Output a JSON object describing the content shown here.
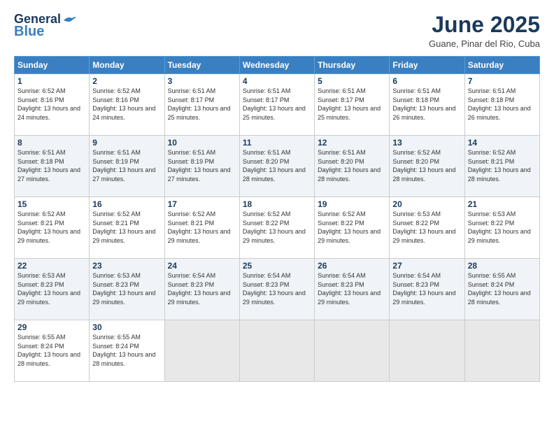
{
  "header": {
    "logo_line1": "General",
    "logo_line2": "Blue",
    "title": "June 2025",
    "subtitle": "Guane, Pinar del Rio, Cuba"
  },
  "calendar": {
    "headers": [
      "Sunday",
      "Monday",
      "Tuesday",
      "Wednesday",
      "Thursday",
      "Friday",
      "Saturday"
    ],
    "weeks": [
      [
        {
          "empty": true
        },
        {
          "empty": true
        },
        {
          "empty": true
        },
        {
          "empty": true
        },
        {
          "empty": true
        },
        {
          "empty": true
        },
        {
          "empty": true
        }
      ]
    ],
    "days": {
      "1": {
        "rise": "6:52 AM",
        "set": "8:16 PM",
        "hours": "13 hours and 24 minutes."
      },
      "2": {
        "rise": "6:52 AM",
        "set": "8:16 PM",
        "hours": "13 hours and 24 minutes."
      },
      "3": {
        "rise": "6:51 AM",
        "set": "8:17 PM",
        "hours": "13 hours and 25 minutes."
      },
      "4": {
        "rise": "6:51 AM",
        "set": "8:17 PM",
        "hours": "13 hours and 25 minutes."
      },
      "5": {
        "rise": "6:51 AM",
        "set": "8:17 PM",
        "hours": "13 hours and 25 minutes."
      },
      "6": {
        "rise": "6:51 AM",
        "set": "8:18 PM",
        "hours": "13 hours and 26 minutes."
      },
      "7": {
        "rise": "6:51 AM",
        "set": "8:18 PM",
        "hours": "13 hours and 26 minutes."
      },
      "8": {
        "rise": "6:51 AM",
        "set": "8:18 PM",
        "hours": "13 hours and 27 minutes."
      },
      "9": {
        "rise": "6:51 AM",
        "set": "8:19 PM",
        "hours": "13 hours and 27 minutes."
      },
      "10": {
        "rise": "6:51 AM",
        "set": "8:19 PM",
        "hours": "13 hours and 27 minutes."
      },
      "11": {
        "rise": "6:51 AM",
        "set": "8:20 PM",
        "hours": "13 hours and 28 minutes."
      },
      "12": {
        "rise": "6:51 AM",
        "set": "8:20 PM",
        "hours": "13 hours and 28 minutes."
      },
      "13": {
        "rise": "6:52 AM",
        "set": "8:20 PM",
        "hours": "13 hours and 28 minutes."
      },
      "14": {
        "rise": "6:52 AM",
        "set": "8:21 PM",
        "hours": "13 hours and 28 minutes."
      },
      "15": {
        "rise": "6:52 AM",
        "set": "8:21 PM",
        "hours": "13 hours and 29 minutes."
      },
      "16": {
        "rise": "6:52 AM",
        "set": "8:21 PM",
        "hours": "13 hours and 29 minutes."
      },
      "17": {
        "rise": "6:52 AM",
        "set": "8:21 PM",
        "hours": "13 hours and 29 minutes."
      },
      "18": {
        "rise": "6:52 AM",
        "set": "8:22 PM",
        "hours": "13 hours and 29 minutes."
      },
      "19": {
        "rise": "6:52 AM",
        "set": "8:22 PM",
        "hours": "13 hours and 29 minutes."
      },
      "20": {
        "rise": "6:53 AM",
        "set": "8:22 PM",
        "hours": "13 hours and 29 minutes."
      },
      "21": {
        "rise": "6:53 AM",
        "set": "8:22 PM",
        "hours": "13 hours and 29 minutes."
      },
      "22": {
        "rise": "6:53 AM",
        "set": "8:23 PM",
        "hours": "13 hours and 29 minutes."
      },
      "23": {
        "rise": "6:53 AM",
        "set": "8:23 PM",
        "hours": "13 hours and 29 minutes."
      },
      "24": {
        "rise": "6:54 AM",
        "set": "8:23 PM",
        "hours": "13 hours and 29 minutes."
      },
      "25": {
        "rise": "6:54 AM",
        "set": "8:23 PM",
        "hours": "13 hours and 29 minutes."
      },
      "26": {
        "rise": "6:54 AM",
        "set": "8:23 PM",
        "hours": "13 hours and 29 minutes."
      },
      "27": {
        "rise": "6:54 AM",
        "set": "8:23 PM",
        "hours": "13 hours and 29 minutes."
      },
      "28": {
        "rise": "6:55 AM",
        "set": "8:24 PM",
        "hours": "13 hours and 28 minutes."
      },
      "29": {
        "rise": "6:55 AM",
        "set": "8:24 PM",
        "hours": "13 hours and 28 minutes."
      },
      "30": {
        "rise": "6:55 AM",
        "set": "8:24 PM",
        "hours": "13 hours and 28 minutes."
      }
    }
  }
}
